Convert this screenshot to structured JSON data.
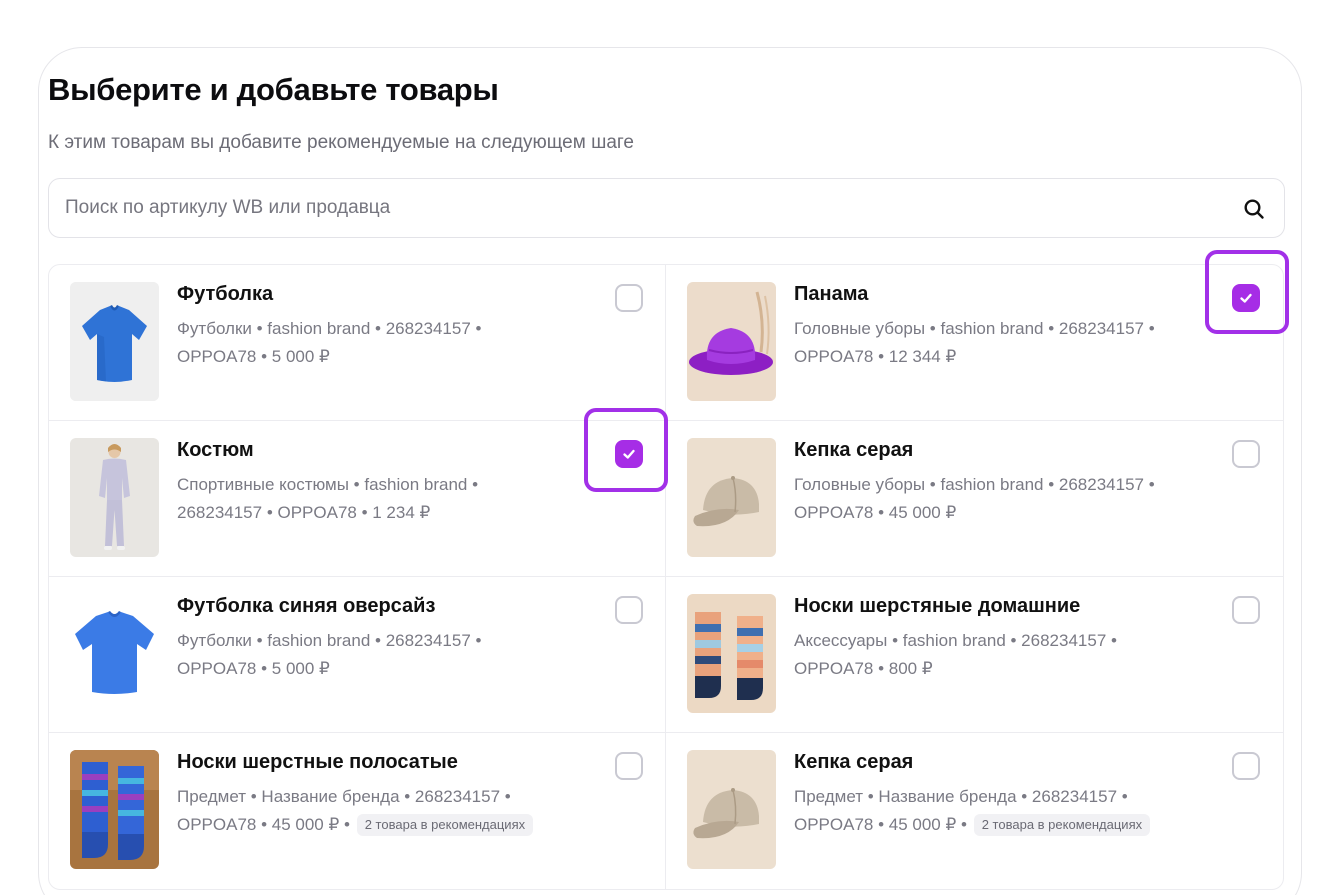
{
  "header": {
    "title": "Выберите и добавьте товары",
    "subtitle": "К этим товарам вы добавите рекомендуемые на следующем шаге"
  },
  "search": {
    "placeholder": "Поиск по артикулу WB или продавца",
    "icon": "search-icon"
  },
  "products": [
    {
      "name": "Футболка",
      "meta_line1": "Футболки • fashion brand • 268234157 •",
      "meta_line2": "OPPOA78 • 5 000 ₽",
      "badge": "",
      "checked": false,
      "image": "blue-tshirt"
    },
    {
      "name": "Панама",
      "meta_line1": "Головные уборы • fashion brand • 268234157 •",
      "meta_line2": "OPPOA78 • 12 344 ₽",
      "badge": "",
      "checked": true,
      "image": "purple-bucket-hat"
    },
    {
      "name": "Костюм",
      "meta_line1": "Спортивные костюмы • fashion brand •",
      "meta_line2": "268234157 • OPPOA78 • 1 234 ₽",
      "badge": "",
      "checked": true,
      "image": "lilac-tracksuit"
    },
    {
      "name": "Кепка серая",
      "meta_line1": "Головные уборы • fashion brand • 268234157 •",
      "meta_line2": "OPPOA78 • 45 000 ₽",
      "badge": "",
      "checked": false,
      "image": "grey-cap"
    },
    {
      "name": "Футболка синяя оверсайз",
      "meta_line1": "Футболки • fashion brand • 268234157 •",
      "meta_line2": "OPPOA78 • 5 000 ₽",
      "badge": "",
      "checked": false,
      "image": "blue-oversize-tshirt"
    },
    {
      "name": "Носки шерстяные домашние",
      "meta_line1": "Аксессуары • fashion brand • 268234157 •",
      "meta_line2": "OPPOA78 • 800 ₽",
      "badge": "",
      "checked": false,
      "image": "striped-wool-socks"
    },
    {
      "name": "Носки шерстные полосатые",
      "meta_line1": "Предмет • Название бренда • 268234157 •",
      "meta_line2": "OPPOA78 • 45 000 ₽ •",
      "badge": "2 товара в рекомендациях",
      "checked": false,
      "image": "blue-patterned-socks"
    },
    {
      "name": "Кепка серая",
      "meta_line1": "Предмет • Название бренда • 268234157 •",
      "meta_line2": "OPPOA78 • 45 000 ₽ •",
      "badge": "2 товара в рекомендациях",
      "checked": false,
      "image": "grey-cap"
    }
  ],
  "colors": {
    "accent": "#a62de6",
    "highlight": "#a230e8",
    "muted_text": "#7a7a84",
    "border": "#ececf0"
  }
}
